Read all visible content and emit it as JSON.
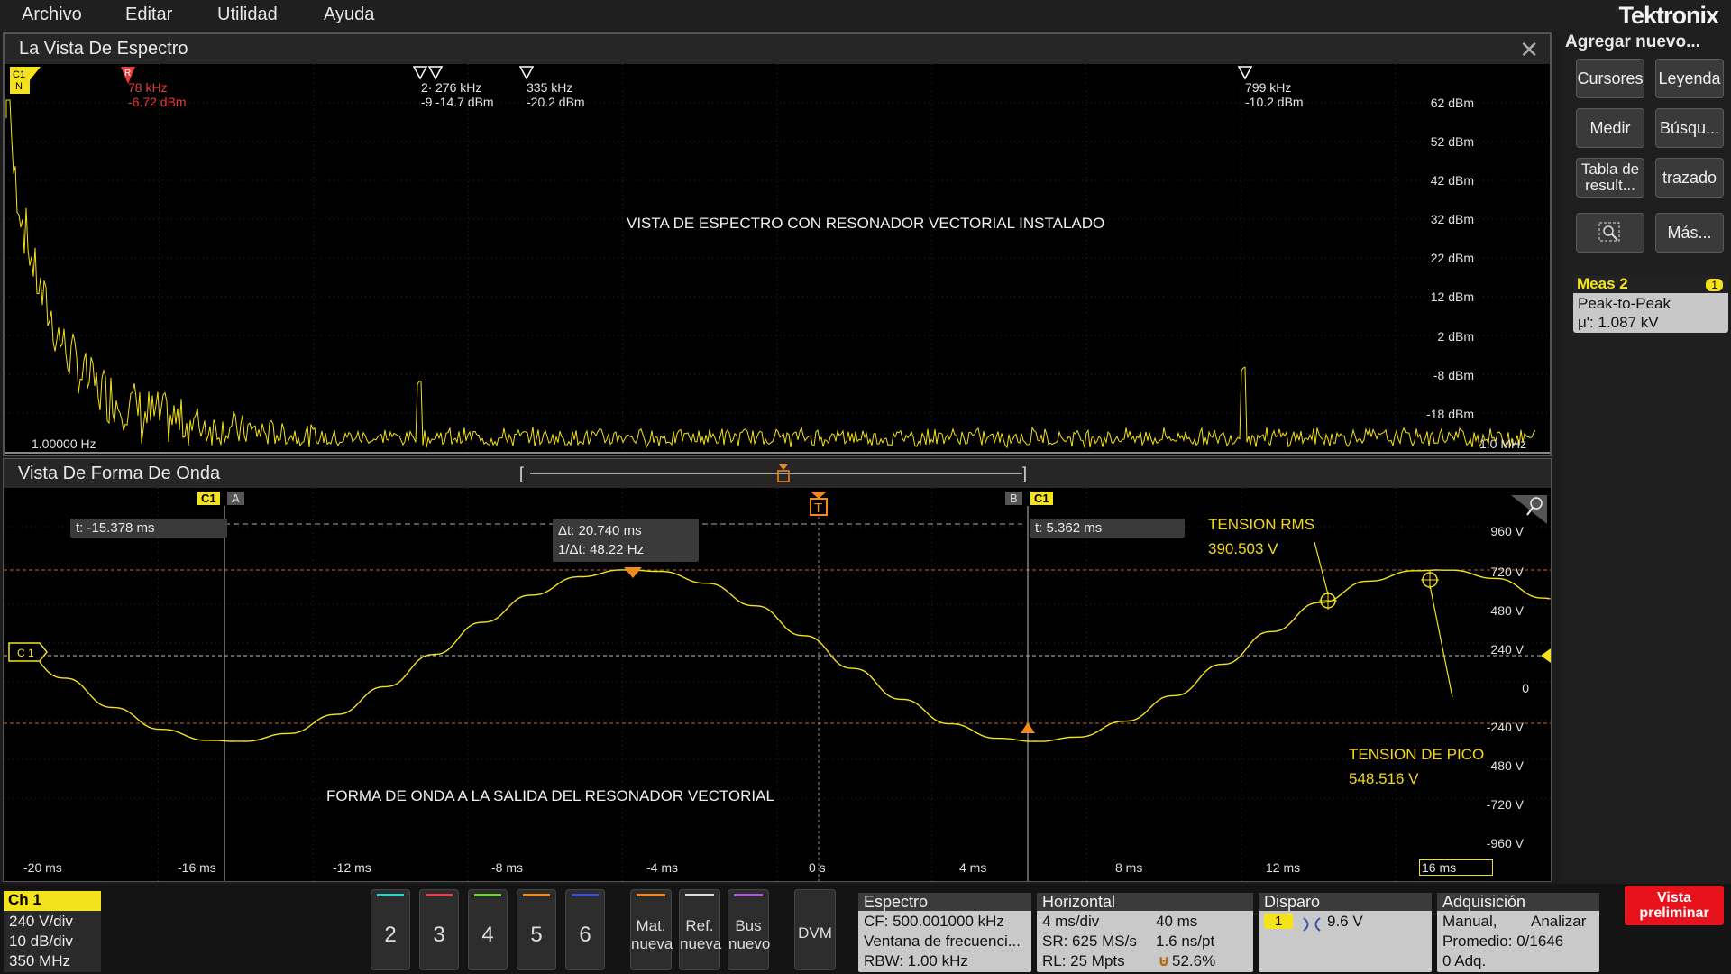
{
  "menu": {
    "items": [
      "Archivo",
      "Editar",
      "Utilidad",
      "Ayuda"
    ],
    "brand": "Tektronix"
  },
  "spectrum": {
    "title": "La Vista De Espectro",
    "channel_badge": [
      "C1",
      "N"
    ],
    "ref_marker": {
      "label": "R",
      "freq": "78 kHz",
      "level": "-6.72 dBm"
    },
    "markers": [
      {
        "freq": "276 kHz",
        "level": "-14.7 dBm",
        "prefix": "2·",
        "prefix2": "-9"
      },
      {
        "freq": "335 kHz",
        "level": "-20.2 dBm"
      },
      {
        "freq": "799 kHz",
        "level": "-10.2 dBm"
      }
    ],
    "annotation": "VISTA DE ESPECTRO CON RESONADOR VECTORIAL INSTALADO",
    "y_labels": [
      "62 dBm",
      "52 dBm",
      "42 dBm",
      "32 dBm",
      "22 dBm",
      "12 dBm",
      "2 dBm",
      "-8 dBm",
      "-18 dBm"
    ],
    "x_start": "1.00000 Hz",
    "x_end": "1.0 MHz"
  },
  "waveform": {
    "title": "Vista De Forma De Onda",
    "cursor_a": {
      "badge": "C1",
      "label": "A",
      "readout": "t: -15.378 ms"
    },
    "cursor_b": {
      "badge": "C1",
      "label": "B",
      "readout": "t: 5.362 ms"
    },
    "delta_readout": [
      "Δt: 20.740 ms",
      "1/Δt: 48.22 Hz"
    ],
    "trigger_label": "T",
    "channel_marker": "C 1",
    "rms_label": [
      "TENSION RMS",
      "390.503 V"
    ],
    "peak_label": [
      "TENSION DE PICO",
      "548.516 V"
    ],
    "annotation": "FORMA DE ONDA A LA SALIDA DEL RESONADOR VECTORIAL",
    "y_labels": [
      "960 V",
      "720 V",
      "480 V",
      "240 V",
      "0",
      "-240 V",
      "-480 V",
      "-720 V",
      "-960 V"
    ],
    "x_labels": [
      "-20 ms",
      "-16 ms",
      "-12 ms",
      "-8 ms",
      "-4 ms",
      "0 s",
      "4 ms",
      "8 ms",
      "12 ms",
      "16 ms"
    ]
  },
  "sidebar": {
    "title": "Agregar nuevo...",
    "buttons": [
      "Cursores",
      "Leyenda",
      "Medir",
      "Búsqu...",
      "Tabla de result...",
      "trazado",
      "",
      "Más..."
    ],
    "meas": {
      "title": "Meas 2",
      "badge": "1",
      "name": "Peak-to-Peak",
      "value": "μ': 1.087 kV"
    }
  },
  "bottom": {
    "ch1": {
      "title": "Ch 1",
      "lines": [
        "240 V/div",
        "10 dB/div",
        "350 MHz"
      ]
    },
    "channels": [
      {
        "num": "2",
        "color": "#2ed3c6"
      },
      {
        "num": "3",
        "color": "#e8404f"
      },
      {
        "num": "4",
        "color": "#6fd13a"
      },
      {
        "num": "5",
        "color": "#f08a1e"
      },
      {
        "num": "6",
        "color": "#3a4fd6"
      }
    ],
    "new_buttons": [
      {
        "label": [
          "Mat.",
          "nueva"
        ],
        "color": "#f08a1e"
      },
      {
        "label": [
          "Ref.",
          "nueva"
        ],
        "color": "#dddddd"
      },
      {
        "label": [
          "Bus",
          "nuevo"
        ],
        "color": "#b05ad6"
      }
    ],
    "dvm": "DVM",
    "espectro": {
      "title": "Espectro",
      "rows": [
        "CF: 500.001000 kHz",
        "Ventana de frecuenci...",
        "RBW: 1.00 kHz"
      ]
    },
    "horizontal": {
      "title": "Horizontal",
      "rows": [
        [
          "4 ms/div",
          "40 ms"
        ],
        [
          "SR: 625 MS/s",
          "1.6 ns/pt"
        ],
        [
          "RL: 25 Mpts",
          "52.6%"
        ]
      ]
    },
    "disparo": {
      "title": "Disparo",
      "badge": "1",
      "value": "9.6 V"
    },
    "adquisicion": {
      "title": "Adquisición",
      "rows": [
        [
          "Manual,",
          "Analizar"
        ],
        [
          "Promedio: 0/1646",
          ""
        ],
        [
          "0 Adq.",
          ""
        ]
      ]
    },
    "preview": [
      "Vista",
      "preliminar"
    ]
  },
  "colors": {
    "trace": "#f4e21c",
    "accent_orange": "#f08a1e",
    "preview_red": "#e8121c"
  }
}
